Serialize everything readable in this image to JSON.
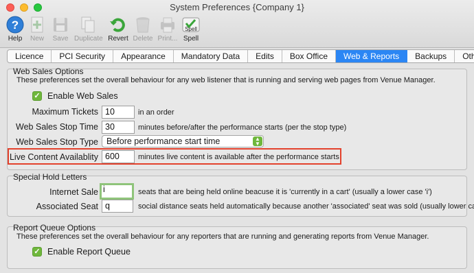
{
  "window": {
    "title": "System Preferences {Company 1}"
  },
  "toolbar": {
    "help": "Help",
    "new": "New",
    "save": "Save",
    "duplicate": "Duplicate",
    "revert": "Revert",
    "delete": "Delete",
    "print": "Print...",
    "spell": "Spell",
    "spell_badge": "Spell"
  },
  "tabs": [
    "Licence",
    "PCI Security",
    "Appearance",
    "Mandatory Data",
    "Edits",
    "Box Office",
    "Web & Reports",
    "Backups",
    "Other"
  ],
  "active_tab": "Web & Reports",
  "web_sales": {
    "title": "Web Sales Options",
    "description": "These preferences set the overall behaviour for any web listener that is running and serving web pages from Venue Manager.",
    "enable_label": "Enable Web Sales",
    "max_tickets_label": "Maximum Tickets",
    "max_tickets_value": "10",
    "max_tickets_hint": "in an order",
    "stop_time_label": "Web Sales Stop Time",
    "stop_time_value": "30",
    "stop_time_hint": "minutes before/after the performance starts (per the stop type)",
    "stop_type_label": "Web Sales Stop Type",
    "stop_type_value": "Before performance start time",
    "live_content_label": "Live Content Availablity",
    "live_content_value": "600",
    "live_content_hint": "minutes live content is available after the performance starts"
  },
  "hold_letters": {
    "title": "Special Hold Letters",
    "internet_sale_label": "Internet Sale",
    "internet_sale_value": "i",
    "internet_sale_hint": "seats that are being held online beacuse it is 'currently in a cart'  (usually a lower case 'i')",
    "associated_seat_label": "Associated Seat",
    "associated_seat_value": "q",
    "associated_seat_hint": "social distance seats held automatically because another 'associated' seat was sold (usually lower case 'q')"
  },
  "report_queue": {
    "title": "Report Queue Options",
    "description": "These preferences set the overall behaviour for any reporters that are running and generating reports from Venue Manager.",
    "enable_label": "Enable Report Queue"
  },
  "colors": {
    "accent": "#2b86f4",
    "check": "#6fb73c",
    "highlight": "#e3412c"
  }
}
